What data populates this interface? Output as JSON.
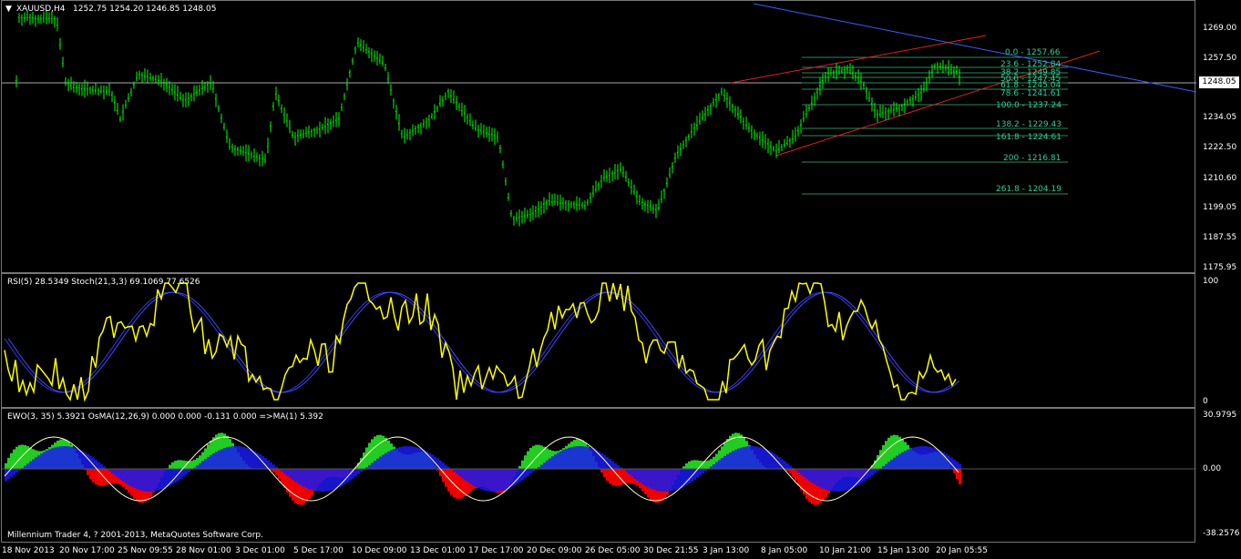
{
  "main": {
    "symbol": "XAUUSD,H4",
    "ohlc": "1252.75 1254.20 1246.85 1248.05",
    "price_labels": [
      "1269.00",
      "1257.50",
      "1246.05",
      "1234.05",
      "1222.50",
      "1210.60",
      "1199.05",
      "1187.55",
      "1175.95"
    ],
    "current_price": "1248.05",
    "fib_levels": [
      "0.0 - 1257.66",
      "23.6 - 1252.84",
      "38.2 - 1249.85",
      "50.0 - 1247.45",
      "61.8 - 1245.04",
      "78.6 - 1241.61",
      "100.0 - 1237.24",
      "138.2 - 1229.43",
      "161.8 - 1224.61",
      "200 - 1216.81",
      "261.8 - 1204.19"
    ]
  },
  "rsi": {
    "title": "RSI(5) 28.5349  Stoch(21,3,3) 69.1069 77.6526",
    "scale_top": "100",
    "scale_bottom": "0"
  },
  "ewo": {
    "title": "EWO(3, 35) 5.3921  OsMA(12,26,9) 0.000 0.000 -0.131 0.000  =>MA(1) 5.392",
    "scale_top": "30.9795",
    "scale_mid": "0.00",
    "scale_bottom": "-38.2576"
  },
  "footer": "Millennium Trader 4, ? 2001-2013, MetaQuotes Software Corp.",
  "time_labels": [
    "18 Nov 2013",
    "20 Nov 17:00",
    "25 Nov 09:55",
    "28 Nov 01:00",
    "3 Dec 01:00",
    "5 Dec 17:00",
    "10 Dec 09:00",
    "13 Dec 01:00",
    "17 Dec 17:00",
    "20 Dec 09:00",
    "26 Dec 05:00",
    "30 Dec 21:55",
    "3 Jan 13:00",
    "8 Jan 05:00",
    "10 Jan 21:00",
    "15 Jan 13:00",
    "20 Jan 05:55"
  ],
  "colors": {
    "bars": "#00ff00",
    "rsi": "#ffff00",
    "stoch": "#3333ff",
    "ewo_pos": "#22cc22",
    "ewo_neg": "#ee0000",
    "osma": "#1a1aee",
    "fib": "#3c9"
  }
}
